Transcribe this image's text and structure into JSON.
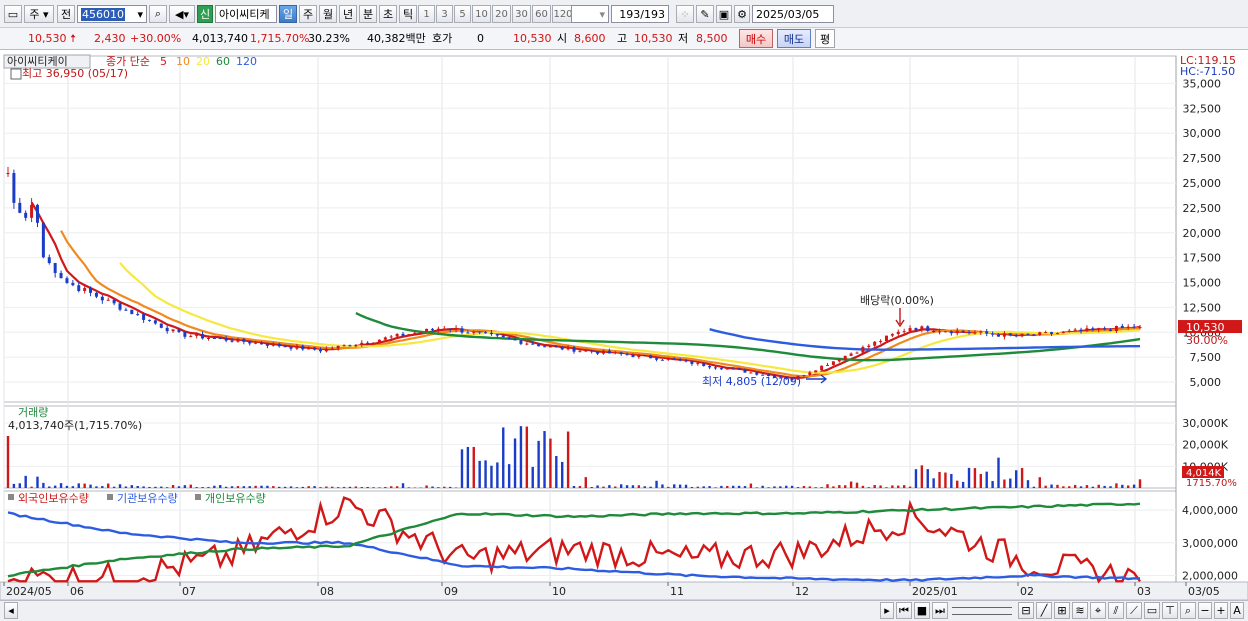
{
  "toolbar": {
    "period_main": "주",
    "prev_label": "전",
    "stock_code": "456010",
    "new_badge": "신",
    "stock_name": "아이씨티케",
    "period_tabs": [
      "일",
      "주",
      "월",
      "년",
      "분",
      "초",
      "틱"
    ],
    "period_selected": "일",
    "numbers": [
      "1",
      "3",
      "5",
      "10",
      "20",
      "30",
      "60",
      "120"
    ],
    "count_display": "193/193",
    "date": "2025/03/05"
  },
  "quote": {
    "price": "10,530",
    "change": "2,430",
    "change_pct": "+30.00%",
    "volume": "4,013,740",
    "volume_pct": "1,715.70%",
    "turnover": "30.23%",
    "amount": "40,382백만",
    "hoga_label": "호가",
    "hoga_value": "0",
    "hoga_price": "10,530",
    "open_label": "시",
    "open_value": "8,600",
    "high_label": "고",
    "high_value": "10,530",
    "low_label": "저",
    "low_value": "8,500",
    "buy_label": "매수",
    "sell_label": "매도",
    "flat_label": "평"
  },
  "price_panel": {
    "name_tag": "아이씨티케이",
    "legend_title": "종가 단순",
    "ma_labels": [
      "5",
      "10",
      "20",
      "60",
      "120"
    ],
    "ma_colors": [
      "#d01818",
      "#f08a1c",
      "#f6e840",
      "#1e8a3a",
      "#2e5ce0"
    ],
    "high_note": "최고 36,950 (05/17)",
    "low_note": "최저 4,805 (12/09)",
    "dividend_note": "배당락(0.00%)",
    "lc_label": "LC:119.15",
    "hc_label": "HC:-71.50",
    "current_tag": "10,530",
    "current_pct_tag": "30.00%",
    "y_ticks": [
      "35,000",
      "32,500",
      "30,000",
      "27,500",
      "25,000",
      "22,500",
      "20,000",
      "17,500",
      "15,000",
      "12,500",
      "10,000",
      "7,500",
      "5,000"
    ]
  },
  "volume_panel": {
    "title": "거래량",
    "note": "4,013,740주(1,715.70%)",
    "y_ticks": [
      "30,000K",
      "20,000K",
      "10,000K"
    ],
    "current_tag": "4,014K",
    "current_pct_tag": "1715.70%"
  },
  "holdings_panel": {
    "legend": [
      "외국인보유수량",
      "기관보유수량",
      "개인보유수량"
    ],
    "legend_colors": [
      "#d01818",
      "#2e5ce0",
      "#1e8a3a"
    ],
    "y_ticks": [
      "4,000,000",
      "3,000,000",
      "2,000,000"
    ]
  },
  "x_axis": {
    "labels": [
      "2024/05",
      "06",
      "07",
      "08",
      "09",
      "10",
      "11",
      "12",
      "2025/01",
      "02",
      "03",
      "03/05"
    ]
  },
  "chart_data": [
    {
      "type": "candlestick",
      "title": "",
      "ylim": [
        3000,
        36950
      ],
      "x": [
        "2024/05",
        "06",
        "07",
        "08",
        "09",
        "10",
        "11",
        "12",
        "2025/01",
        "02",
        "03"
      ],
      "series": [
        {
          "name": "종가",
          "values": [
            22000,
            15000,
            9800,
            8200,
            10500,
            8500,
            7300,
            5300,
            10500,
            9600,
            10530
          ]
        },
        {
          "name": "5",
          "values": [
            22500,
            15200,
            9900,
            8100,
            10600,
            8600,
            7400,
            5400,
            10800,
            9700,
            9200
          ]
        },
        {
          "name": "10",
          "values": [
            20500,
            15800,
            10200,
            8000,
            10400,
            8700,
            7500,
            5600,
            10500,
            9800,
            9300
          ]
        },
        {
          "name": "20",
          "values": [
            null,
            17500,
            11500,
            8200,
            9600,
            8900,
            7600,
            6000,
            10000,
            9900,
            9400
          ]
        },
        {
          "name": "60",
          "values": [
            null,
            null,
            null,
            11500,
            9000,
            8500,
            7900,
            7600,
            7300,
            8300,
            8600
          ]
        },
        {
          "name": "120",
          "values": [
            null,
            null,
            null,
            null,
            null,
            null,
            null,
            10500,
            8900,
            8500,
            8300
          ]
        }
      ]
    },
    {
      "type": "bar",
      "title": "거래량",
      "x": [
        "2024/05",
        "06",
        "07",
        "08",
        "09",
        "10",
        "11",
        "12",
        "2025/01",
        "02",
        "03"
      ],
      "values": [
        2000,
        1200,
        900,
        700,
        24000,
        1500,
        900,
        1200,
        9000,
        1500,
        4014
      ]
    },
    {
      "type": "line",
      "x": [
        "2024/05",
        "06",
        "07",
        "08",
        "09",
        "10",
        "11",
        "12",
        "2025/01",
        "02",
        "03"
      ],
      "series": [
        {
          "name": "외국인보유수량",
          "values": [
            1900000,
            1950000,
            2600000,
            4200000,
            2500000,
            2800000,
            2500000,
            2700000,
            3800000,
            2400000,
            1900000
          ]
        },
        {
          "name": "기관보유수량",
          "values": [
            3900000,
            3300000,
            3000000,
            3000000,
            2300000,
            2200000,
            2000000,
            1900000,
            1850000,
            2000000,
            1900000
          ]
        },
        {
          "name": "개인보유수량",
          "values": [
            2000000,
            2500000,
            2800000,
            2900000,
            3900000,
            3800000,
            3900000,
            3900000,
            4000000,
            4100000,
            4200000
          ]
        }
      ]
    }
  ]
}
